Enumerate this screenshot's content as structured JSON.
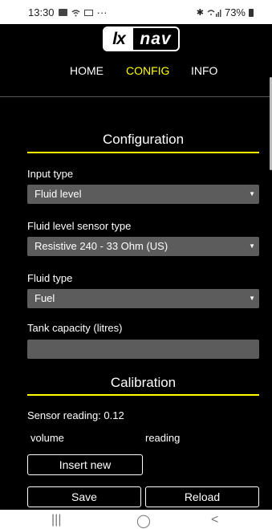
{
  "status_bar": {
    "time": "13:30",
    "dots": "···",
    "battery": "73%",
    "icons": [
      "image-icon",
      "wifi-icon",
      "mail-icon",
      "bluetooth-icon",
      "wifi-signal-icon",
      "battery-icon"
    ]
  },
  "logo": {
    "part1": "lx",
    "part2": "nav"
  },
  "nav": {
    "items": [
      {
        "label": "HOME",
        "active": false
      },
      {
        "label": "CONFIG",
        "active": true
      },
      {
        "label": "INFO",
        "active": false
      }
    ],
    "active_color": "#ffff00"
  },
  "configuration": {
    "title": "Configuration",
    "input_type": {
      "label": "Input type",
      "value": "Fluid level"
    },
    "sensor_type": {
      "label": "Fluid level sensor type",
      "value": "Resistive 240 - 33 Ohm (US)"
    },
    "fluid_type": {
      "label": "Fluid type",
      "value": "Fuel"
    },
    "tank_capacity": {
      "label": "Tank capacity (litres)",
      "value": ""
    }
  },
  "calibration": {
    "title": "Calibration",
    "sensor_reading": "Sensor reading: 0.12",
    "col_volume": "volume",
    "col_reading": "reading",
    "insert_new": "Insert new",
    "save": "Save",
    "reload": "Reload"
  },
  "android_nav": {
    "recents": "|||",
    "home": "◯",
    "back": "<"
  },
  "colors": {
    "accent": "#ffff00",
    "field_bg": "#5c5c5c",
    "background": "#000000"
  }
}
